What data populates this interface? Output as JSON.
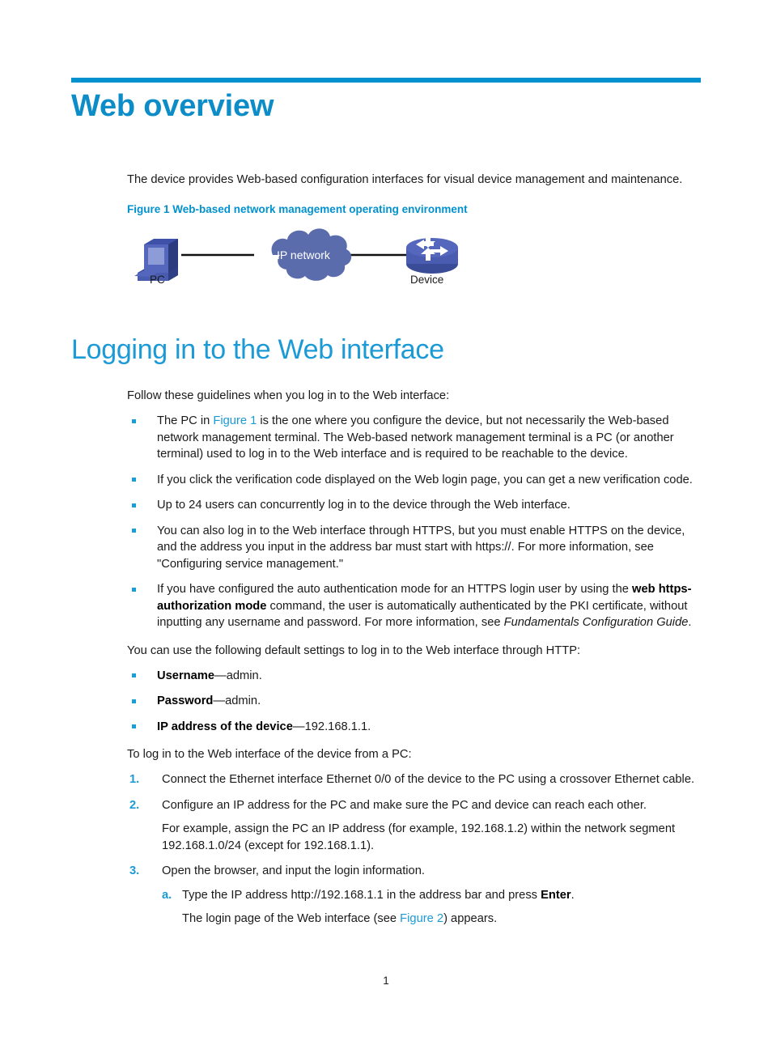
{
  "document": {
    "page_number": "1"
  },
  "heading1": {
    "text": "Web overview",
    "rule_color": "#0091ce",
    "text_color": "#0c8dc8"
  },
  "intro_paragraph": "The device provides Web-based configuration interfaces for visual device management and maintenance.",
  "figure": {
    "caption": "Figure 1 Web-based network management operating environment",
    "caption_color": "#0091ce",
    "cloud_label": "IP network",
    "cloud_color": "#5b6cad",
    "pc_label": "PC",
    "device_label": "Device",
    "link_color": "#000000"
  },
  "heading2": {
    "text": "Logging in to the Web interface",
    "text_color": "#1c9ad6"
  },
  "guidelines": {
    "intro": "Follow these guidelines when you log in to the Web interface:",
    "items": [
      {
        "parts": [
          {
            "type": "text",
            "value": "The PC in "
          },
          {
            "type": "xref",
            "value": "Figure 1"
          },
          {
            "type": "text",
            "value": " is the one where you configure the device, but not necessarily the Web-based network management terminal. The Web-based network management terminal is a PC (or another terminal) used to log in to the Web interface and is required to be reachable to the device."
          }
        ]
      },
      {
        "parts": [
          {
            "type": "text",
            "value": "If you click the verification code displayed on the Web login page, you can get a new verification code."
          }
        ]
      },
      {
        "parts": [
          {
            "type": "text",
            "value": "Up to 24 users can concurrently log in to the device through the Web interface."
          }
        ]
      },
      {
        "parts": [
          {
            "type": "text",
            "value": "You can also log in to the Web interface through HTTPS, but you must enable HTTPS on the device, and the address you input in the address bar must start with https://. For more information, see \"Configuring service management.\""
          }
        ]
      },
      {
        "parts": [
          {
            "type": "text",
            "value": "If you have configured the auto authentication mode for an HTTPS login user by using the "
          },
          {
            "type": "bold",
            "value": "web https-authorization mode"
          },
          {
            "type": "text",
            "value": " command, the user is automatically authenticated by the PKI certificate, without inputting any username and password. For more information, see "
          },
          {
            "type": "italic",
            "value": "Fundamentals Configuration Guide"
          },
          {
            "type": "text",
            "value": "."
          }
        ]
      }
    ]
  },
  "defaults": {
    "intro": "You can use the following default settings to log in to the Web interface through HTTP:",
    "items": [
      {
        "label": "Username",
        "separator": "—",
        "value": "admin."
      },
      {
        "label": "Password",
        "separator": "—",
        "value": "admin."
      },
      {
        "label": "IP address of the device",
        "separator": "—",
        "value": "192.168.1.1."
      }
    ]
  },
  "procedure": {
    "intro": "To log in to the Web interface of the device from a PC:",
    "steps": [
      {
        "num": "1.",
        "text": "Connect the Ethernet interface Ethernet 0/0 of the device to the PC using a crossover Ethernet cable."
      },
      {
        "num": "2.",
        "text": "Configure an IP address for the PC and make sure the PC and device can reach each other.",
        "sub_paragraph": "For example, assign the PC an IP address (for example, 192.168.1.2) within the network segment 192.168.1.0/24 (except for 192.168.1.1)."
      },
      {
        "num": "3.",
        "text": "Open the browser, and input the login information.",
        "substeps": [
          {
            "alpha": "a.",
            "parts": [
              {
                "type": "text",
                "value": "Type the IP address http://192.168.1.1 in the address bar and press "
              },
              {
                "type": "bold",
                "value": "Enter"
              },
              {
                "type": "text",
                "value": "."
              }
            ]
          }
        ],
        "sub_result": {
          "parts": [
            {
              "type": "text",
              "value": "The login page of the Web interface (see "
            },
            {
              "type": "xref",
              "value": "Figure 2"
            },
            {
              "type": "text",
              "value": ") appears."
            }
          ]
        }
      }
    ]
  }
}
